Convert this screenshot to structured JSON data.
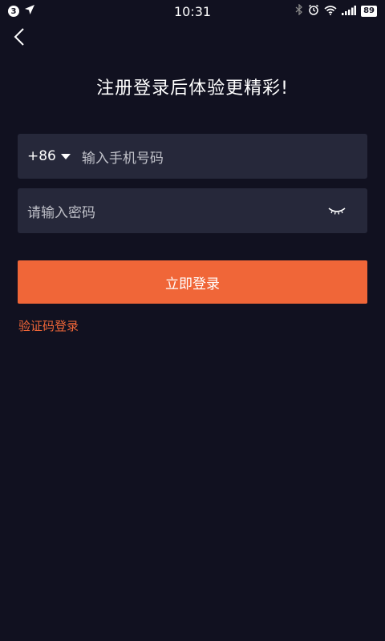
{
  "status_bar": {
    "notification_count": "3",
    "time": "10:31",
    "battery": "89",
    "icons": [
      "notification-badge-icon",
      "location-arrow-icon",
      "bluetooth-icon",
      "alarm-icon",
      "wifi-icon",
      "signal-icon",
      "battery-icon"
    ]
  },
  "nav": {
    "back_icon": "chevron-left-icon"
  },
  "page": {
    "title": "注册登录后体验更精彩!"
  },
  "phone_field": {
    "country_code": "+86",
    "placeholder": "输入手机号码"
  },
  "password_field": {
    "placeholder": "请输入密码",
    "toggle_icon": "eye-closed-icon"
  },
  "actions": {
    "login_label": "立即登录",
    "sms_login_label": "验证码登录"
  },
  "colors": {
    "background": "#111120",
    "field_bg": "#26283a",
    "accent": "#f06638"
  }
}
